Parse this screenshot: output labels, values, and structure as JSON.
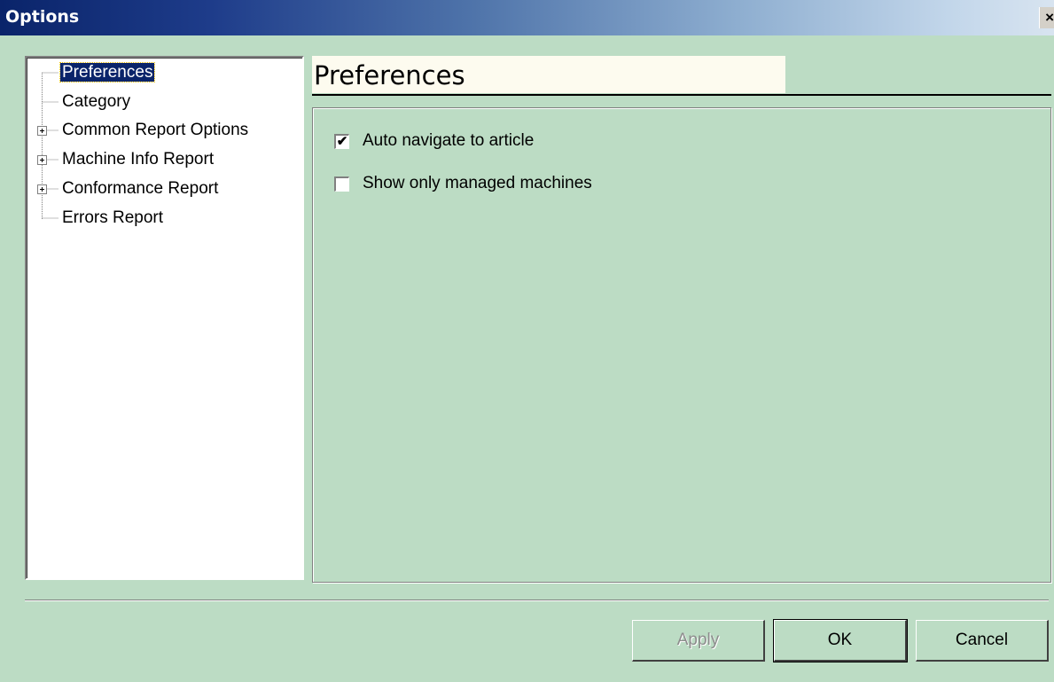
{
  "window": {
    "title": "Options",
    "close_label": "×"
  },
  "tree": {
    "items": [
      {
        "label": "Preferences",
        "expandable": false,
        "selected": true
      },
      {
        "label": "Category",
        "expandable": false,
        "selected": false
      },
      {
        "label": "Common Report Options",
        "expandable": true,
        "selected": false
      },
      {
        "label": "Machine Info Report",
        "expandable": true,
        "selected": false
      },
      {
        "label": "Conformance Report",
        "expandable": true,
        "selected": false
      },
      {
        "label": "Errors Report",
        "expandable": false,
        "selected": false
      }
    ]
  },
  "panel": {
    "title": "Preferences",
    "options": [
      {
        "label": "Auto navigate to article",
        "checked": true,
        "checkmark": "✔"
      },
      {
        "label": "Show only managed machines",
        "checked": false,
        "checkmark": ""
      }
    ]
  },
  "buttons": {
    "apply": "Apply",
    "ok": "OK",
    "cancel": "Cancel"
  },
  "colors": {
    "background": "#bcdcc4",
    "titlebar_start": "#0a246a",
    "selection": "#0a246a",
    "header_box": "#fdfbef"
  }
}
